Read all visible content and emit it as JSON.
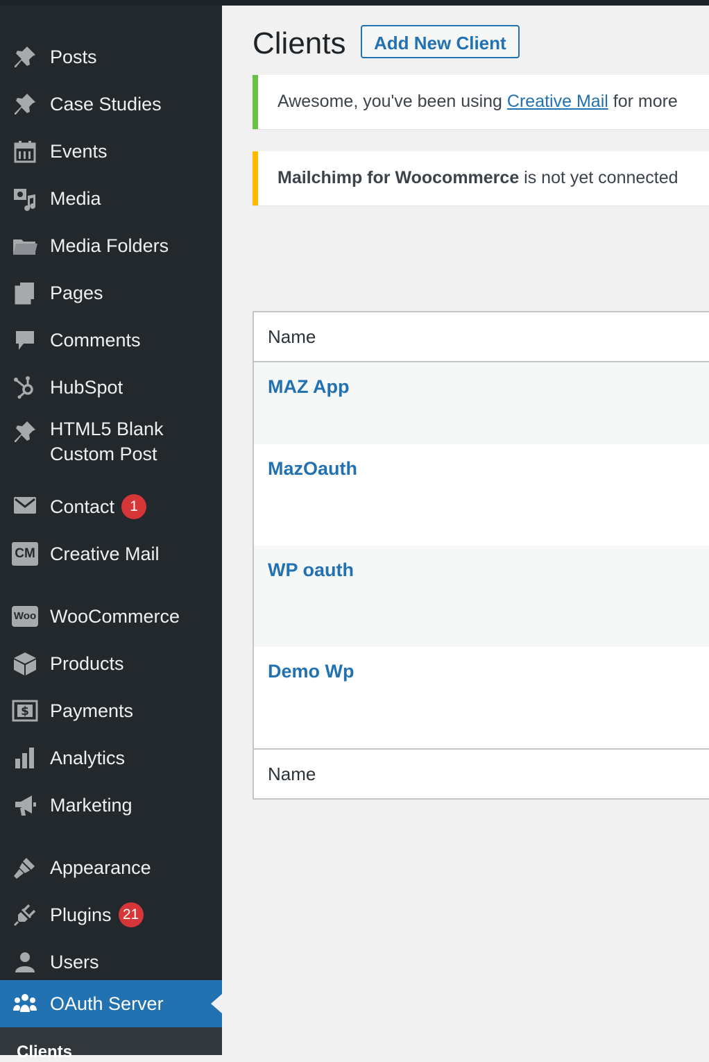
{
  "sidebar": {
    "items": [
      {
        "label": "Posts",
        "icon": "pin-icon"
      },
      {
        "label": "Case Studies",
        "icon": "pin-icon"
      },
      {
        "label": "Events",
        "icon": "calendar-icon"
      },
      {
        "label": "Media",
        "icon": "media-icon"
      },
      {
        "label": "Media Folders",
        "icon": "folder-icon"
      },
      {
        "label": "Pages",
        "icon": "pages-icon"
      },
      {
        "label": "Comments",
        "icon": "comment-icon"
      },
      {
        "label": "HubSpot",
        "icon": "hubspot-icon"
      },
      {
        "label": "HTML5 Blank",
        "label2": "Custom Post",
        "icon": "pin-icon"
      },
      {
        "label": "Contact",
        "badge": "1",
        "icon": "mail-icon"
      },
      {
        "label": "Creative Mail",
        "icon_text": "CM",
        "icon": "creative-mail-icon"
      },
      {
        "label": "WooCommerce",
        "icon_text": "Woo",
        "icon": "woocommerce-icon"
      },
      {
        "label": "Products",
        "icon": "box-icon"
      },
      {
        "label": "Payments",
        "icon": "dollar-icon"
      },
      {
        "label": "Analytics",
        "icon": "bar-chart-icon"
      },
      {
        "label": "Marketing",
        "icon": "megaphone-icon"
      },
      {
        "label": "Appearance",
        "icon": "brush-icon"
      },
      {
        "label": "Plugins",
        "badge": "21",
        "icon": "plugin-icon"
      },
      {
        "label": "Users",
        "icon": "user-icon"
      },
      {
        "label": "OAuth Server",
        "icon": "groups-icon",
        "active": true
      }
    ],
    "submenu_label": "Clients"
  },
  "header": {
    "title": "Clients",
    "add_button": "Add New Client"
  },
  "notices": {
    "green": {
      "prefix": "Awesome, you've been using ",
      "link": "Creative Mail",
      "suffix": " for more"
    },
    "yellow": {
      "bold": "Mailchimp for Woocommerce",
      "suffix": " is not yet connected"
    }
  },
  "table": {
    "column_header": "Name",
    "rows": [
      "MAZ App",
      "MazOauth",
      "WP oauth",
      "Demo Wp"
    ]
  },
  "colors": {
    "sidebar": "#23282d",
    "accent": "#2271b1",
    "badge": "#d63638",
    "notice_green": "#68c24a",
    "notice_yellow": "#ffb900"
  }
}
